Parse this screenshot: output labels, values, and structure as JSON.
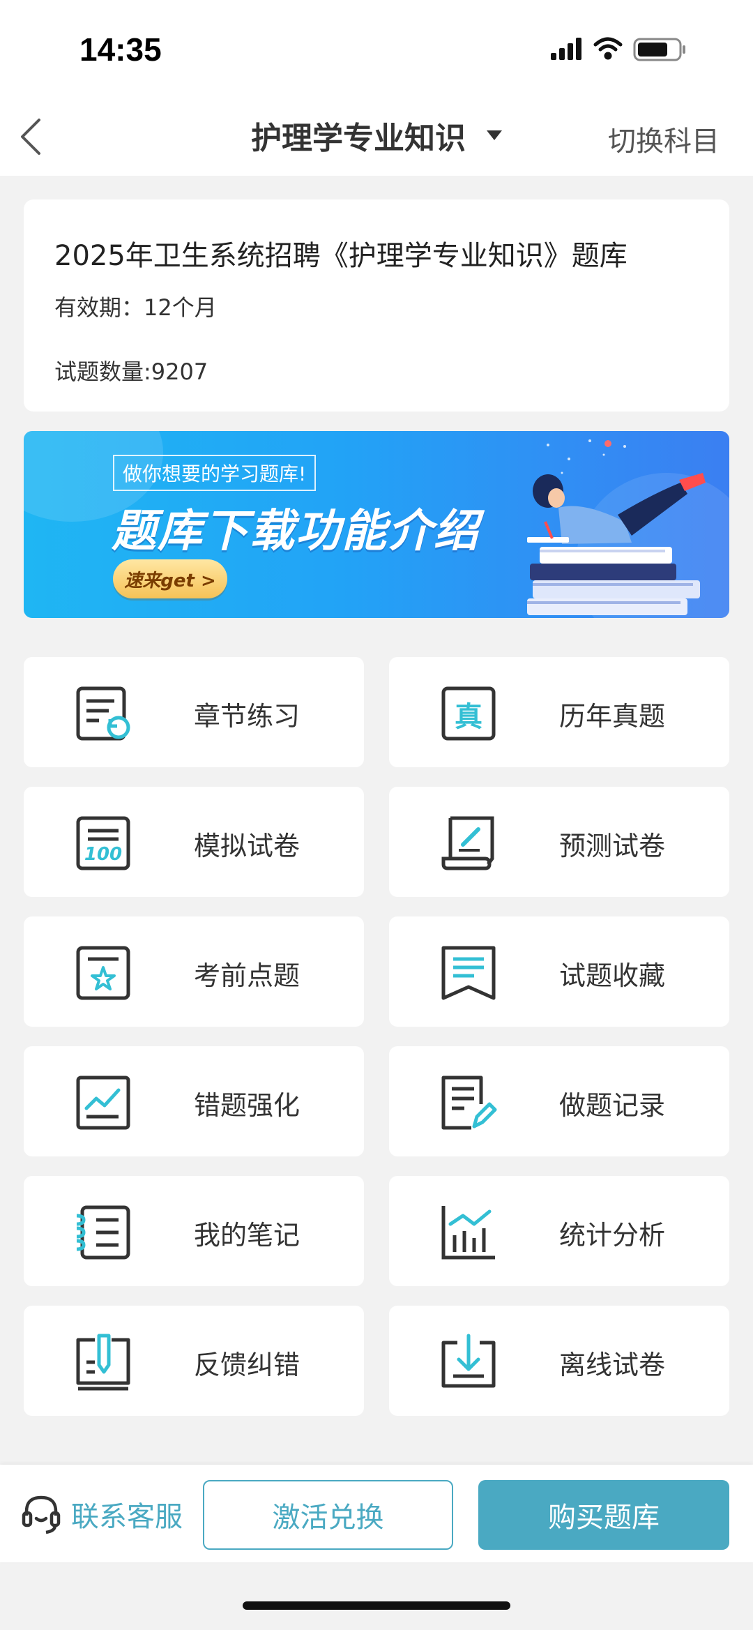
{
  "status_bar": {
    "time": "14:35"
  },
  "nav": {
    "title": "护理学专业知识",
    "switch_label": "切换科目"
  },
  "info_card": {
    "title": "2025年卫生系统招聘《护理学专业知识》题库",
    "validity": "有效期：12个月",
    "question_count": "试题数量:9207"
  },
  "banner": {
    "subtitle": "做你想要的学习题库!",
    "headline": "题库下载功能介绍",
    "cta": "速来get >"
  },
  "menu": {
    "items": [
      {
        "label": "章节练习",
        "icon": "chapter-practice-icon"
      },
      {
        "label": "历年真题",
        "icon": "past-exams-icon"
      },
      {
        "label": "模拟试卷",
        "icon": "mock-exam-icon"
      },
      {
        "label": "预测试卷",
        "icon": "predict-exam-icon"
      },
      {
        "label": "考前点题",
        "icon": "pre-exam-tips-icon"
      },
      {
        "label": "试题收藏",
        "icon": "bookmark-icon"
      },
      {
        "label": "错题强化",
        "icon": "wrong-questions-icon"
      },
      {
        "label": "做题记录",
        "icon": "practice-record-icon"
      },
      {
        "label": "我的笔记",
        "icon": "notebook-icon"
      },
      {
        "label": "统计分析",
        "icon": "statistics-icon"
      },
      {
        "label": "反馈纠错",
        "icon": "feedback-icon"
      },
      {
        "label": "离线试卷",
        "icon": "download-icon"
      }
    ]
  },
  "bottom_bar": {
    "contact_label": "联系客服",
    "activate_label": "激活兑换",
    "buy_label": "购买题库"
  },
  "colors": {
    "accent": "#4aa9c2",
    "icon_stroke": "#333333",
    "icon_highlight": "#33bfd4",
    "background": "#f2f2f2"
  }
}
